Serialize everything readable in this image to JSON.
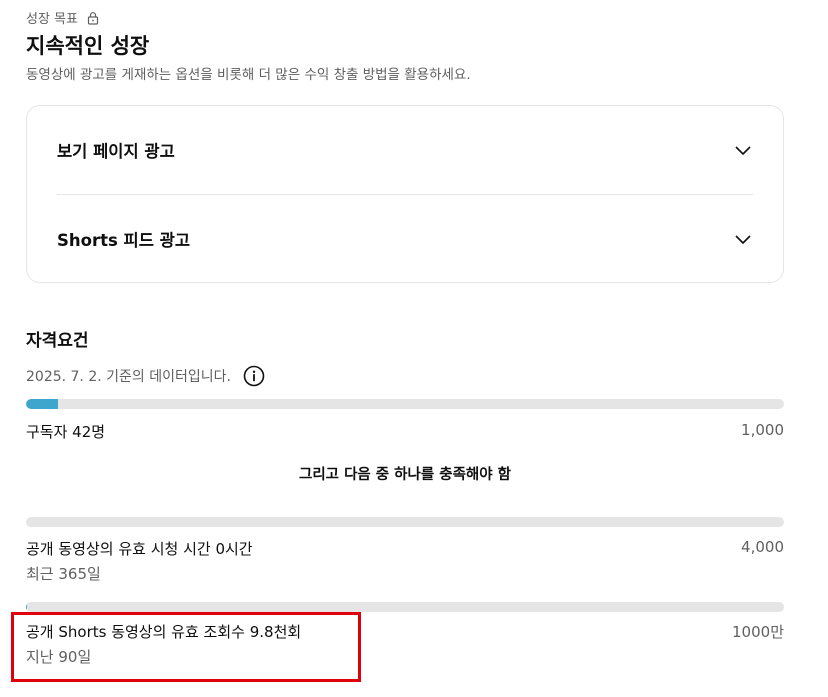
{
  "header": {
    "eyebrow": "성장 목표",
    "title": "지속적인 성장",
    "subtitle": "동영상에 광고를 게재하는 옵션을 비롯해 더 많은 수익 창출 방법을 활용하세요."
  },
  "ad_options": [
    {
      "label": "보기 페이지 광고"
    },
    {
      "label": "Shorts 피드 광고"
    }
  ],
  "eligibility": {
    "title": "자격요건",
    "date_note": "2025. 7. 2. 기준의 데이터입니다.",
    "subscribers": {
      "label": "구독자 42명",
      "target": "1,000",
      "progress_fraction": 0.042
    },
    "and_condition": "그리고 다음 중 하나를 충족해야 함",
    "watch_hours": {
      "label": "공개 동영상의 유효 시청 시간 0시간",
      "sub": "최근 365일",
      "target": "4,000",
      "progress_fraction": 0
    },
    "shorts_views": {
      "label": "공개 Shorts 동영상의 유효 조회수 9.8천회",
      "sub": "지난 90일",
      "target": "1000만",
      "progress_fraction": 0.001
    }
  },
  "colors": {
    "accent": "#3ea6cc",
    "highlight": "#e0000b",
    "track": "#e5e5e5"
  }
}
